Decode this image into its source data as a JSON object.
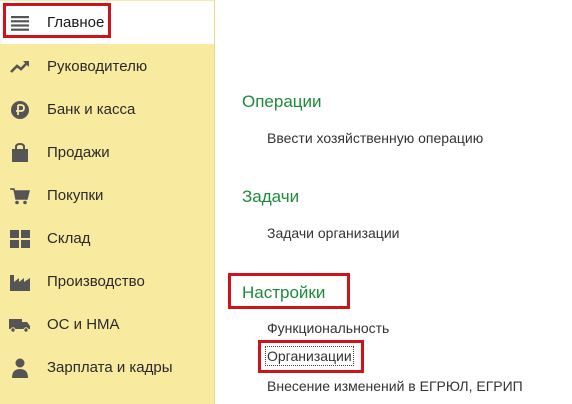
{
  "sidebar": {
    "items": [
      {
        "label": "Главное",
        "icon": "menu-icon"
      },
      {
        "label": "Руководителю",
        "icon": "trend-up-icon"
      },
      {
        "label": "Банк и касса",
        "icon": "ruble-coin-icon"
      },
      {
        "label": "Продажи",
        "icon": "shopping-bag-icon"
      },
      {
        "label": "Покупки",
        "icon": "cart-icon"
      },
      {
        "label": "Склад",
        "icon": "warehouse-grid-icon"
      },
      {
        "label": "Производство",
        "icon": "factory-icon"
      },
      {
        "label": "ОС и НМА",
        "icon": "truck-icon"
      },
      {
        "label": "Зарплата и кадры",
        "icon": "person-icon"
      }
    ]
  },
  "main": {
    "sections": [
      {
        "title": "Операции",
        "links": [
          "Ввести хозяйственную операцию"
        ]
      },
      {
        "title": "Задачи",
        "links": [
          "Задачи организации"
        ]
      },
      {
        "title": "Настройки",
        "links": [
          "Функциональность",
          "Организации",
          "Внесение изменений в ЕГРЮЛ, ЕГРИП"
        ]
      }
    ]
  },
  "colors": {
    "sidebar_bg": "#f8ea9f",
    "section_title": "#1d8a3c",
    "highlight": "#d0121b"
  }
}
